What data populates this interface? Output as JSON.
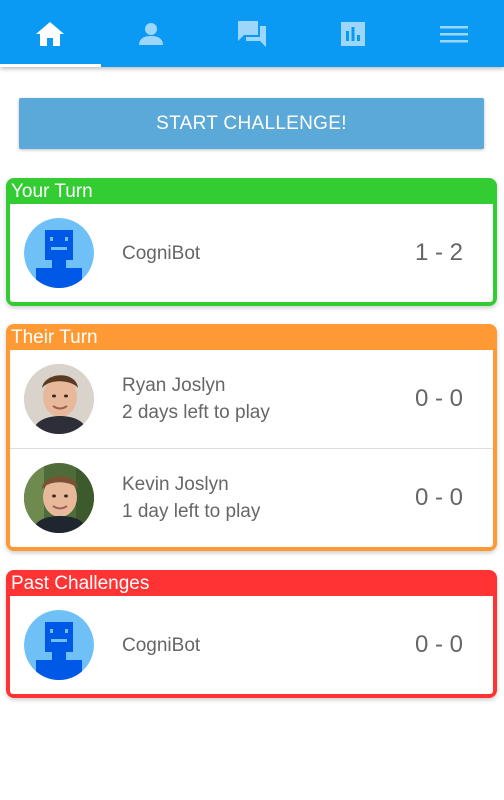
{
  "nav": {
    "tabs": [
      {
        "icon": "home-icon",
        "active": true
      },
      {
        "icon": "person-icon",
        "active": false
      },
      {
        "icon": "chat-icon",
        "active": false
      },
      {
        "icon": "stats-icon",
        "active": false
      },
      {
        "icon": "menu-icon",
        "active": false
      }
    ]
  },
  "start_button": {
    "label": "START CHALLENGE!"
  },
  "sections": {
    "your_turn": {
      "title": "Your Turn",
      "color": "#33cc33",
      "rows": [
        {
          "name": "CogniBot",
          "subtitle": "",
          "score": "1 - 2",
          "avatar": "robot-avatar"
        }
      ]
    },
    "their_turn": {
      "title": "Their Turn",
      "color": "#ff9933",
      "rows": [
        {
          "name": "Ryan Joslyn",
          "subtitle": "2 days left to play",
          "score": "0 - 0",
          "avatar": "photo-avatar"
        },
        {
          "name": "Kevin Joslyn",
          "subtitle": "1 day left to play",
          "score": "0 - 0",
          "avatar": "photo-avatar"
        }
      ]
    },
    "past": {
      "title": "Past Challenges",
      "color": "#ff3333",
      "rows": [
        {
          "name": "CogniBot",
          "subtitle": "",
          "score": "0 - 0",
          "avatar": "robot-avatar"
        }
      ]
    }
  },
  "colors": {
    "topbar": "#0a9af4",
    "button": "#5ba9d8",
    "robot_bg": "#6ec0f7",
    "robot_fg": "#0059e6"
  }
}
